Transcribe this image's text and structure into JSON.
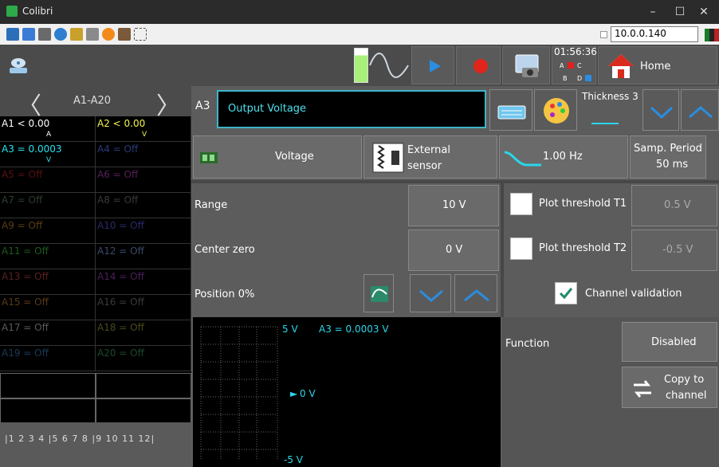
{
  "window": {
    "title": "Colibri",
    "min": "–",
    "max": "☐",
    "close": "✕"
  },
  "toolbar": {
    "ip": "10.0.0.140"
  },
  "top": {
    "clock": "01:56:36",
    "sensors": [
      "A",
      "C",
      "B",
      "D"
    ],
    "home": "Home"
  },
  "left": {
    "title": "A1-A20",
    "prev": "〈",
    "next": "〉",
    "channels": [
      {
        "label": "A1 <  0.00",
        "unit": "A",
        "color": "#ffffff",
        "bg": "#000"
      },
      {
        "label": "A2 <  0.00",
        "unit": "V",
        "color": "#f3f34d",
        "bg": "#000"
      },
      {
        "label": "A3 = 0.0003",
        "unit": "V",
        "color": "#27e3f0",
        "bg": "#000"
      },
      {
        "label": "A4 = Off",
        "unit": "",
        "color": "#2a3a7a",
        "bg": "#000"
      },
      {
        "label": "A5 = Off",
        "unit": "",
        "color": "#5a1111",
        "bg": "#000"
      },
      {
        "label": "A6 = Off",
        "unit": "",
        "color": "#5a1f5a",
        "bg": "#000"
      },
      {
        "label": "A7 = Off",
        "unit": "",
        "color": "#2e3e2e",
        "bg": "#000"
      },
      {
        "label": "A8 = Off",
        "unit": "",
        "color": "#3a3a3a",
        "bg": "#000"
      },
      {
        "label": "A9 = Off",
        "unit": "",
        "color": "#5a3f16",
        "bg": "#000"
      },
      {
        "label": "A10 = Off",
        "unit": "",
        "color": "#2a2a6a",
        "bg": "#000"
      },
      {
        "label": "A11 = Off",
        "unit": "",
        "color": "#1d5a1d",
        "bg": "#000"
      },
      {
        "label": "A12 = Off",
        "unit": "",
        "color": "#3a4a6a",
        "bg": "#000"
      },
      {
        "label": "A13 = Off",
        "unit": "",
        "color": "#5a2020",
        "bg": "#000"
      },
      {
        "label": "A14 = Off",
        "unit": "",
        "color": "#4a1f5a",
        "bg": "#000"
      },
      {
        "label": "A15 = Off",
        "unit": "",
        "color": "#5a3a16",
        "bg": "#000"
      },
      {
        "label": "A16 = Off",
        "unit": "",
        "color": "#3a3a3a",
        "bg": "#000"
      },
      {
        "label": "A17 = Off",
        "unit": "",
        "color": "#5a5a5a",
        "bg": "#000"
      },
      {
        "label": "A18 = Off",
        "unit": "",
        "color": "#4a4a1a",
        "bg": "#000"
      },
      {
        "label": "A19 = Off",
        "unit": "",
        "color": "#1a3a5a",
        "bg": "#000"
      },
      {
        "label": "A20 = Off",
        "unit": "",
        "color": "#1a4a2a",
        "bg": "#000"
      }
    ],
    "pages": "|1  2  3  4 |5  6  7  8 |9  10 11 12|"
  },
  "main": {
    "channel": "A3",
    "name": "Output Voltage",
    "thickness": "Thickness 3",
    "type_btn": "Voltage",
    "sensor_line1": "External",
    "sensor_line2": "sensor",
    "filter": "1.00 Hz",
    "samp_line1": "Samp. Period",
    "samp_line2": "50 ms",
    "range_label": "Range",
    "range_value": "10 V",
    "center_label": "Center zero",
    "center_value": "0 V",
    "position_label": "Position 0%",
    "t1_label": "Plot threshold T1",
    "t1_value": "0.5 V",
    "t2_label": "Plot threshold T2",
    "t2_value": "-0.5 V",
    "validation": "Channel validation",
    "scope_top": "5 V",
    "scope_readout": "A3 = 0.0003 V",
    "scope_mid": "0 V",
    "scope_bottom": "-5 V",
    "function_label": "Function",
    "function_value": "Disabled",
    "copy_line1": "Copy to",
    "copy_line2": "channel"
  }
}
